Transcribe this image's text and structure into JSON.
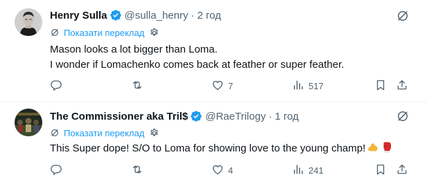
{
  "colors": {
    "accent": "#1d9bf0",
    "text_primary": "#0f1419",
    "text_secondary": "#536471",
    "divider": "#eff3f4"
  },
  "tweets": [
    {
      "author_name": "Henry Sulla",
      "handle": "@sulla_henry",
      "separator": "·",
      "time": "2 год",
      "verified": true,
      "translate_label": "Показати переклад",
      "text_lines": [
        "Mason looks a lot bigger than Loma.",
        "I wonder if Lomachenko comes back at feather or super feather."
      ],
      "reply_count": "",
      "repost_count": "",
      "like_count": "7",
      "view_count": "517",
      "icons": [
        "reply-icon",
        "repost-icon",
        "like-icon",
        "views-icon",
        "bookmark-icon",
        "share-icon",
        "grok-icon"
      ]
    },
    {
      "author_name": "The Commissioner aka Tril$",
      "handle": "@RaeTrilogy",
      "separator": "·",
      "time": "1 год",
      "verified": true,
      "translate_label": "Показати переклад",
      "text": "This Super dope! S/O to Loma for showing love to the young champ!",
      "emojis": [
        "flexed-biceps-emoji",
        "boxing-glove-emoji"
      ],
      "reply_count": "",
      "repost_count": "",
      "like_count": "4",
      "view_count": "241",
      "icons": [
        "reply-icon",
        "repost-icon",
        "like-icon",
        "views-icon",
        "bookmark-icon",
        "share-icon",
        "grok-icon"
      ]
    }
  ]
}
